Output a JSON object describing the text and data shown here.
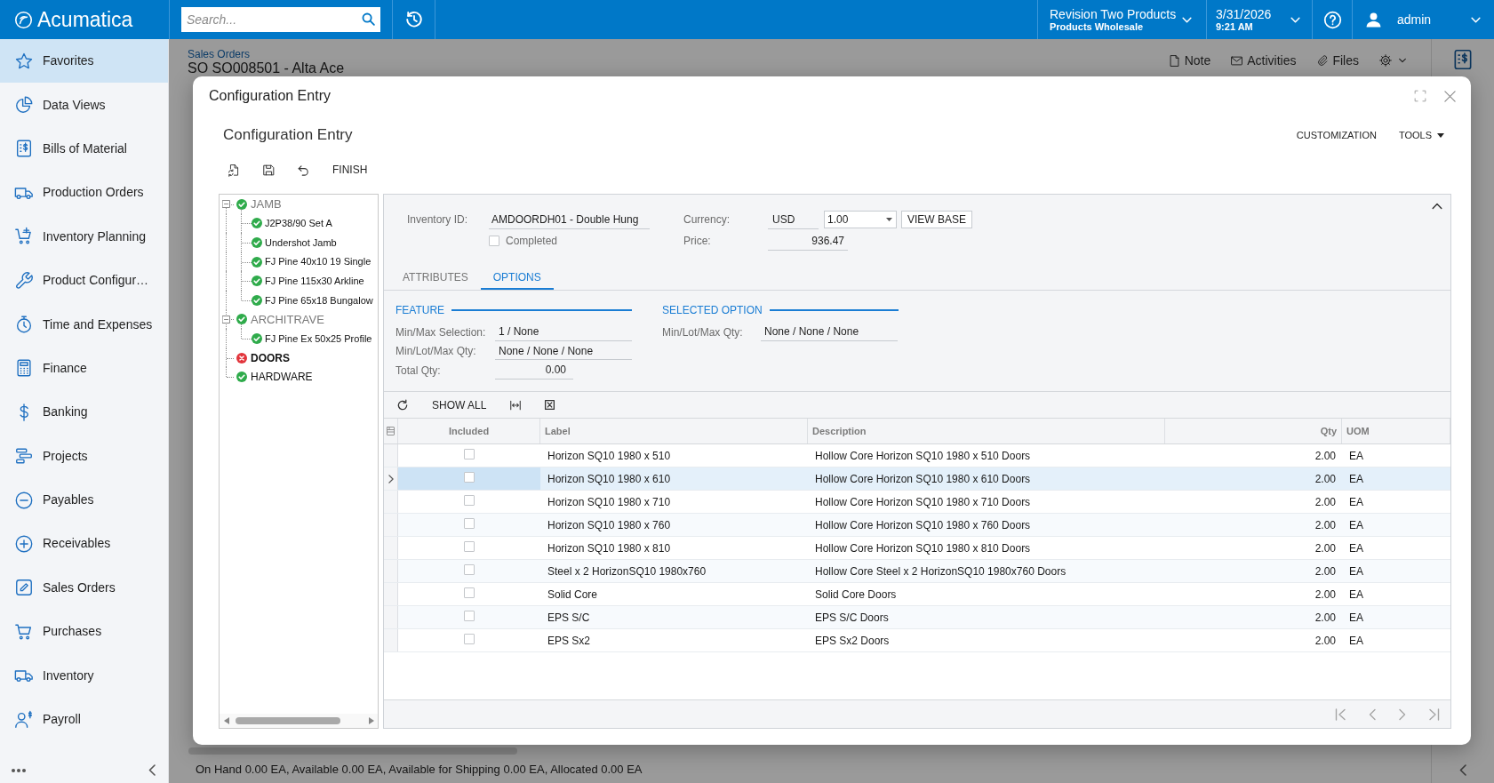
{
  "topbar": {
    "logo": "Acumatica",
    "search": {
      "placeholder": "Search..."
    },
    "company": {
      "name": "Revision Two Products",
      "branch": "Products Wholesale"
    },
    "date": {
      "date": "3/31/2026",
      "time": "9:21 AM"
    },
    "user": {
      "name": "admin"
    }
  },
  "sidebar": {
    "items": [
      {
        "label": "Favorites",
        "selected": true
      },
      {
        "label": "Data Views",
        "selected": false
      },
      {
        "label": "Bills of Material",
        "selected": false
      },
      {
        "label": "Production Orders",
        "selected": false
      },
      {
        "label": "Inventory Planning",
        "selected": false
      },
      {
        "label": "Product Configur…",
        "selected": false
      },
      {
        "label": "Time and Expenses",
        "selected": false
      },
      {
        "label": "Finance",
        "selected": false
      },
      {
        "label": "Banking",
        "selected": false
      },
      {
        "label": "Projects",
        "selected": false
      },
      {
        "label": "Payables",
        "selected": false
      },
      {
        "label": "Receivables",
        "selected": false
      },
      {
        "label": "Sales Orders",
        "selected": false
      },
      {
        "label": "Purchases",
        "selected": false
      },
      {
        "label": "Inventory",
        "selected": false
      },
      {
        "label": "Payroll",
        "selected": false
      }
    ]
  },
  "page": {
    "breadcrumb": "Sales Orders",
    "title": "SO SO008501 - Alta Ace",
    "toolbar": [
      "Note",
      "Activities",
      "Files"
    ],
    "status_bar": "On Hand 0.00 EA, Available 0.00 EA, Available for Shipping 0.00 EA, Allocated 0.00 EA"
  },
  "dialog": {
    "title": "Configuration Entry",
    "heading": "Configuration Entry",
    "header_actions": [
      {
        "label": "CUSTOMIZATION",
        "kind": "plain"
      },
      {
        "label": "TOOLS",
        "kind": "menu"
      }
    ],
    "toolbar": {
      "finish": "FINISH"
    },
    "tree": [
      {
        "label": "JAMB",
        "error": false,
        "greyed": true,
        "selected": false,
        "expanded": true,
        "children": [
          {
            "label": "J2P38/90 Set A",
            "error": false,
            "selected": false
          },
          {
            "label": "Undershot Jamb",
            "error": false,
            "selected": false
          },
          {
            "label": "FJ Pine 40x10 19 Single",
            "error": false,
            "selected": false
          },
          {
            "label": "FJ Pine 115x30 Arkline",
            "error": false,
            "selected": false
          },
          {
            "label": "FJ Pine 65x18 Bungalow",
            "error": false,
            "selected": false
          }
        ]
      },
      {
        "label": "ARCHITRAVE",
        "error": false,
        "greyed": true,
        "selected": false,
        "expanded": true,
        "children": [
          {
            "label": "FJ Pine Ex 50x25 Profile",
            "error": false,
            "selected": false
          }
        ]
      },
      {
        "label": "DOORS",
        "error": true,
        "greyed": false,
        "selected": true
      },
      {
        "label": "HARDWARE",
        "error": false,
        "greyed": false,
        "selected": false
      }
    ],
    "form": {
      "inventory_id": {
        "label": "Inventory ID:",
        "value": "AMDOORDH01 - Double Hung"
      },
      "completed": {
        "label": "Completed",
        "checked": false
      },
      "currency": {
        "label": "Currency:",
        "code": "USD",
        "rate": "1.00",
        "button": "VIEW BASE"
      },
      "price": {
        "label": "Price:",
        "value": "936.47"
      }
    },
    "tabs": [
      {
        "label": "ATTRIBUTES",
        "selected": false
      },
      {
        "label": "OPTIONS",
        "selected": true
      }
    ],
    "feature": {
      "title": "FEATURE",
      "fields": [
        {
          "label": "Min/Max Selection:",
          "value": "1 / None",
          "kind": "text"
        },
        {
          "label": "Min/Lot/Max Qty:",
          "value": "None / None / None",
          "kind": "text"
        },
        {
          "label": "Total Qty:",
          "value": "0.00",
          "kind": "number"
        }
      ]
    },
    "selected_option": {
      "title": "SELECTED OPTION",
      "fields": [
        {
          "label": "Min/Lot/Max Qty:",
          "value": "None / None / None",
          "kind": "text"
        }
      ]
    },
    "grid": {
      "toolbar": {
        "show_all": "SHOW ALL"
      },
      "columns": [
        "Included",
        "Label",
        "Description",
        "Qty",
        "UOM"
      ],
      "rows": [
        {
          "selected": false,
          "included": false,
          "label": "Horizon SQ10 1980 x 510",
          "description": "Hollow Core Horizon SQ10 1980 x 510 Doors",
          "qty": "2.00",
          "uom": "EA"
        },
        {
          "selected": true,
          "included": false,
          "label": "Horizon SQ10 1980 x 610",
          "description": "Hollow Core Horizon SQ10 1980 x 610 Doors",
          "qty": "2.00",
          "uom": "EA"
        },
        {
          "selected": false,
          "included": false,
          "label": "Horizon SQ10 1980 x 710",
          "description": "Hollow Core Horizon SQ10 1980 x 710 Doors",
          "qty": "2.00",
          "uom": "EA"
        },
        {
          "selected": false,
          "included": false,
          "label": "Horizon SQ10 1980 x 760",
          "description": "Hollow Core Horizon SQ10 1980 x 760 Doors",
          "qty": "2.00",
          "uom": "EA"
        },
        {
          "selected": false,
          "included": false,
          "label": "Horizon SQ10 1980 x 810",
          "description": "Hollow Core Horizon SQ10 1980 x 810 Doors",
          "qty": "2.00",
          "uom": "EA"
        },
        {
          "selected": false,
          "included": false,
          "label": "Steel x 2 HorizonSQ10 1980x760",
          "description": "Hollow Core Steel x 2 HorizonSQ10 1980x760 Doors",
          "qty": "2.00",
          "uom": "EA"
        },
        {
          "selected": false,
          "included": false,
          "label": "Solid Core",
          "description": "Solid Core Doors",
          "qty": "2.00",
          "uom": "EA"
        },
        {
          "selected": false,
          "included": false,
          "label": "EPS S/C",
          "description": "EPS S/C Doors",
          "qty": "2.00",
          "uom": "EA"
        },
        {
          "selected": false,
          "included": false,
          "label": "EPS Sx2",
          "description": "EPS Sx2 Doors",
          "qty": "2.00",
          "uom": "EA"
        }
      ]
    }
  }
}
